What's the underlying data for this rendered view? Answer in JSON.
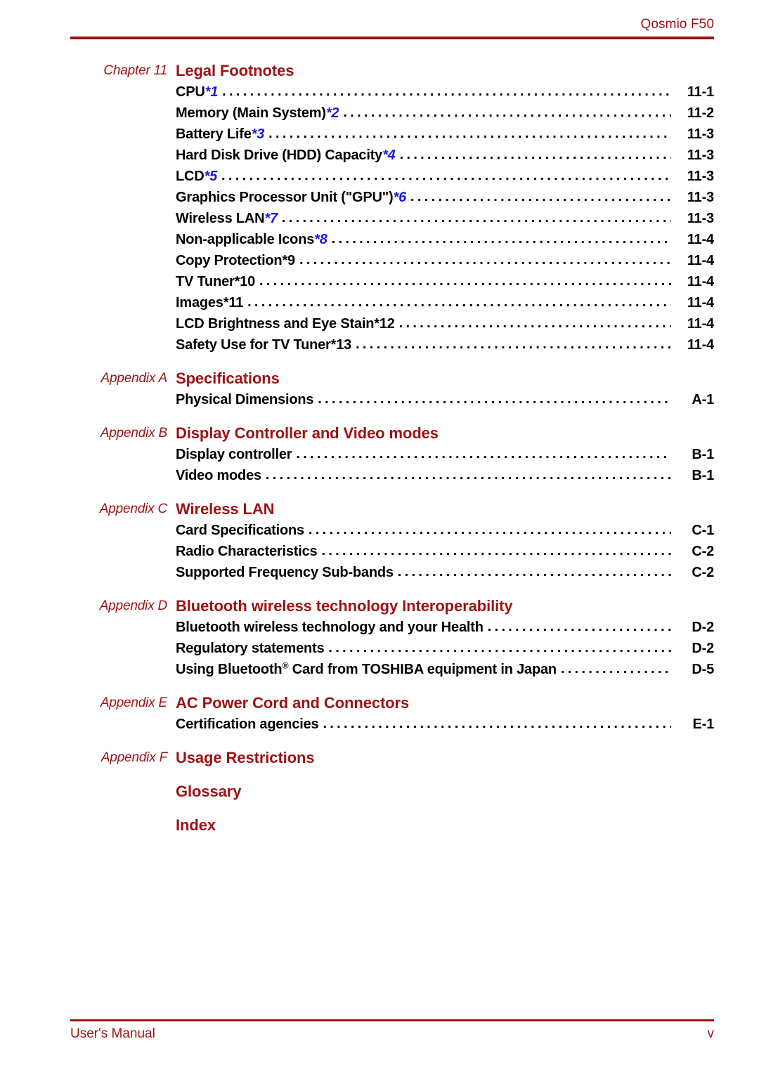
{
  "header": {
    "title": "Qosmio F50"
  },
  "footer": {
    "left": "User's Manual",
    "page": "v"
  },
  "colors": {
    "accent_red": "#9E1114",
    "footnote_blue": "#1A1AE6",
    "text_black": "#000000",
    "background": "#FFFFFF"
  },
  "toc": {
    "groups": [
      {
        "prefix": "Chapter 11",
        "title": "Legal Footnotes",
        "entries": [
          {
            "label": "CPU",
            "mark": "*1",
            "mark_color": "blue",
            "page": "11-1"
          },
          {
            "label": "Memory (Main System)",
            "mark": "*2",
            "mark_color": "blue",
            "page": "11-2"
          },
          {
            "label": "Battery Life",
            "mark": "*3",
            "mark_color": "blue",
            "page": "11-3"
          },
          {
            "label": "Hard Disk Drive (HDD) Capacity",
            "mark": "*4",
            "mark_color": "blue",
            "page": "11-3"
          },
          {
            "label": "LCD",
            "mark": "*5",
            "mark_color": "blue",
            "page": "11-3"
          },
          {
            "label": "Graphics Processor Unit (\"GPU\")",
            "mark": "*6",
            "mark_color": "blue",
            "page": "11-3"
          },
          {
            "label": "Wireless LAN",
            "mark": "*7",
            "mark_color": "blue",
            "page": "11-3"
          },
          {
            "label": "Non-applicable Icons",
            "mark": "*8",
            "mark_color": "blue",
            "page": "11-4"
          },
          {
            "label": "Copy Protection",
            "mark": "*9",
            "mark_color": "black",
            "page": "11-4"
          },
          {
            "label": "TV Tuner",
            "mark": "*10",
            "mark_color": "black",
            "page": "11-4"
          },
          {
            "label": "Images",
            "mark": "*11",
            "mark_color": "black",
            "page": "11-4"
          },
          {
            "label": "LCD Brightness and Eye Stain",
            "mark": "*12",
            "mark_color": "black",
            "page": "11-4"
          },
          {
            "label": "Safety Use for TV Tuner",
            "mark": "*13",
            "mark_color": "black",
            "page": "11-4"
          }
        ]
      },
      {
        "prefix": "Appendix A",
        "title": "Specifications",
        "entries": [
          {
            "label": "Physical Dimensions",
            "mark": "",
            "mark_color": "none",
            "page": "A-1"
          }
        ]
      },
      {
        "prefix": "Appendix B",
        "title": "Display Controller and Video modes",
        "entries": [
          {
            "label": "Display controller",
            "mark": "",
            "mark_color": "none",
            "page": "B-1"
          },
          {
            "label": "Video modes",
            "mark": "",
            "mark_color": "none",
            "page": "B-1"
          }
        ]
      },
      {
        "prefix": "Appendix C",
        "title": "Wireless LAN",
        "entries": [
          {
            "label": "Card Specifications",
            "mark": "",
            "mark_color": "none",
            "page": "C-1"
          },
          {
            "label": "Radio Characteristics",
            "mark": "",
            "mark_color": "none",
            "page": "C-2"
          },
          {
            "label": "Supported Frequency Sub-bands",
            "mark": "",
            "mark_color": "none",
            "page": "C-2"
          }
        ]
      },
      {
        "prefix": "Appendix D",
        "title": "Bluetooth wireless technology Interoperability",
        "entries": [
          {
            "label": "Bluetooth wireless technology and your Health",
            "mark": "",
            "mark_color": "none",
            "page": "D-2"
          },
          {
            "label": "Regulatory statements",
            "mark": "",
            "mark_color": "none",
            "page": "D-2"
          },
          {
            "label": "Using Bluetooth® Card from TOSHIBA equipment in Japan",
            "mark": "",
            "mark_color": "none",
            "page": "D-5",
            "superscript_reg": true
          }
        ]
      },
      {
        "prefix": "Appendix E",
        "title": "AC Power Cord and Connectors",
        "entries": [
          {
            "label": "Certification agencies",
            "mark": "",
            "mark_color": "none",
            "page": "E-1"
          }
        ]
      },
      {
        "prefix": "Appendix F",
        "title": "Usage Restrictions",
        "entries": []
      },
      {
        "prefix": "",
        "title": "Glossary",
        "entries": []
      },
      {
        "prefix": "",
        "title": "Index",
        "entries": []
      }
    ]
  }
}
